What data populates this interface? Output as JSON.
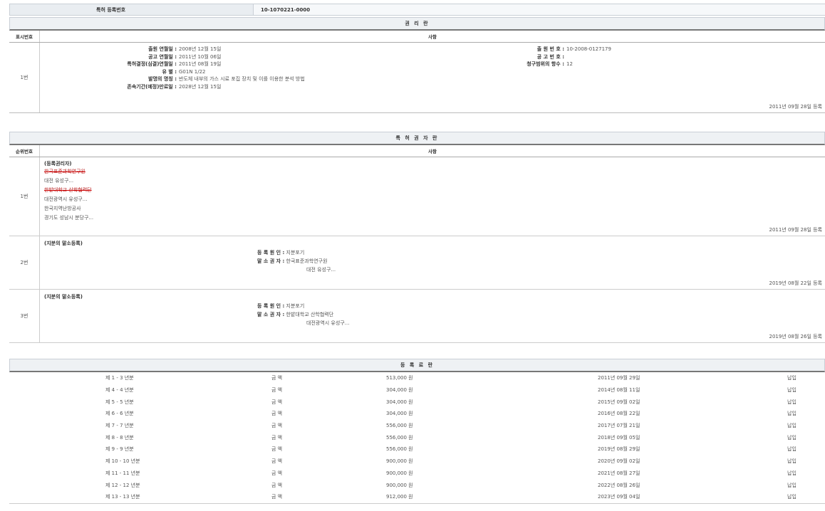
{
  "header": {
    "label": "특허 등록번호",
    "value": "10-1070221-0000"
  },
  "rights": {
    "title": "권 리 란",
    "col1": "표시번호",
    "col2": "사항",
    "row_num": "1번",
    "left": [
      {
        "k": "출원 연월일 :",
        "v": "2008년 12월 15일"
      },
      {
        "k": "공고 연월일 :",
        "v": "2011년 10월 06일"
      },
      {
        "k": "특허결정(심결)연월일 :",
        "v": "2011년 08월 19일"
      },
      {
        "k": "유 별 :",
        "v": "G01N 1/22"
      },
      {
        "k": "발명의 명칭 :",
        "v": "반도체 내부의 가스 시료 포집 장치 및 이를 이용한 분석 방법"
      },
      {
        "k": "존속기간(예정)만료일 :",
        "v": "2028년 12월 15일"
      }
    ],
    "right": [
      {
        "k": "출 원 번 호 :",
        "v": "10-2008-0127179"
      },
      {
        "k": "공 고 번 호 :",
        "v": ""
      },
      {
        "k": "청구범위의 항수 :",
        "v": "12"
      }
    ],
    "reg_date": "2011년 09월 28일 등록"
  },
  "holders": {
    "title": "특 허 권 자 란",
    "col1": "순위번호",
    "col2": "사항",
    "rows": [
      {
        "num": "1번",
        "heading": "(등록권리자)",
        "lines": [
          {
            "text": "한국표준과학연구원",
            "struck": true
          },
          {
            "text": "대전 유성구...",
            "struck": false
          },
          {
            "text": "한밭대학교 산학협력단",
            "struck": true
          },
          {
            "text": "대전광역시 유성구...",
            "struck": false
          },
          {
            "text": "한국지역난방공사",
            "struck": false
          },
          {
            "text": "경기도 성남시 분당구...",
            "struck": false
          }
        ],
        "reg": "2011년 09월 28일 등록"
      },
      {
        "num": "2번",
        "heading": "(지분의 말소등록)",
        "cause_k": "등 록 원 인 :",
        "cause_v": "지분포기",
        "holder_k": "말 소 권 자 :",
        "holder_v": "한국표준과학연구원",
        "addr": "대전 유성구...",
        "reg": "2019년 08월 22일 등록"
      },
      {
        "num": "3번",
        "heading": "(지분의 말소등록)",
        "cause_k": "등 록 원 인 :",
        "cause_v": "지분포기",
        "holder_k": "말 소 권 자 :",
        "holder_v": "한밭대학교 산학협력단",
        "addr": "대전광역시 유성구...",
        "reg": "2019년 08월 26일 등록"
      }
    ]
  },
  "fees": {
    "title": "등 록 료 란",
    "rows": [
      {
        "year": "제 1 - 3 년분",
        "label": "금 액",
        "amount": "513,000 원",
        "date": "2011년 09월 29일",
        "status": "납입"
      },
      {
        "year": "제 4 - 4 년분",
        "label": "금 액",
        "amount": "304,000 원",
        "date": "2014년 08월 11일",
        "status": "납입"
      },
      {
        "year": "제 5 - 5 년분",
        "label": "금 액",
        "amount": "304,000 원",
        "date": "2015년 09월 02일",
        "status": "납입"
      },
      {
        "year": "제 6 - 6 년분",
        "label": "금 액",
        "amount": "304,000 원",
        "date": "2016년 08월 22일",
        "status": "납입"
      },
      {
        "year": "제 7 - 7 년분",
        "label": "금 액",
        "amount": "556,000 원",
        "date": "2017년 07월 21일",
        "status": "납입"
      },
      {
        "year": "제 8 - 8 년분",
        "label": "금 액",
        "amount": "556,000 원",
        "date": "2018년 09월 05일",
        "status": "납입"
      },
      {
        "year": "제 9 - 9 년분",
        "label": "금 액",
        "amount": "556,000 원",
        "date": "2019년 08월 29일",
        "status": "납입"
      },
      {
        "year": "제 10 - 10 년분",
        "label": "금 액",
        "amount": "900,000 원",
        "date": "2020년 09월 02일",
        "status": "납입"
      },
      {
        "year": "제 11 - 11 년분",
        "label": "금 액",
        "amount": "900,000 원",
        "date": "2021년 08월 27일",
        "status": "납입"
      },
      {
        "year": "제 12 - 12 년분",
        "label": "금 액",
        "amount": "900,000 원",
        "date": "2022년 08월 26일",
        "status": "납입"
      },
      {
        "year": "제 13 - 13 년분",
        "label": "금 액",
        "amount": "912,000 원",
        "date": "2023년 09월 04일",
        "status": "납입"
      }
    ]
  }
}
